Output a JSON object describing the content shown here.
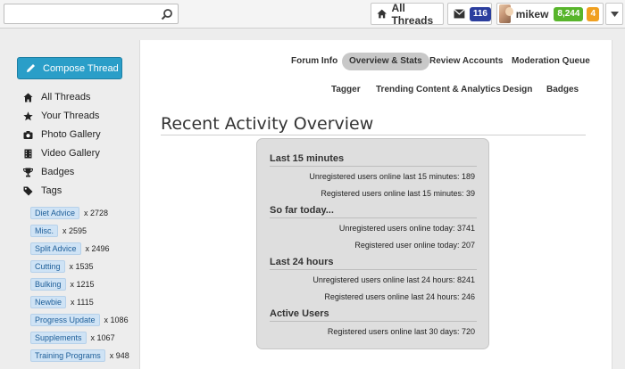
{
  "search": {
    "placeholder": ""
  },
  "topbar": {
    "all_threads_label": "All Threads",
    "mail_count": "116",
    "username": "mikew",
    "points": "8,244",
    "alerts": "4"
  },
  "sidebar": {
    "compose_label": "Compose Thread",
    "nav": [
      {
        "label": "All Threads",
        "icon": "home-icon"
      },
      {
        "label": "Your Threads",
        "icon": "star-icon"
      },
      {
        "label": "Photo Gallery",
        "icon": "camera-icon"
      },
      {
        "label": "Video Gallery",
        "icon": "video-icon"
      },
      {
        "label": "Badges",
        "icon": "trophy-icon"
      },
      {
        "label": "Tags",
        "icon": "tag-icon"
      }
    ],
    "tags": [
      {
        "name": "Diet Advice",
        "count": "x 2728"
      },
      {
        "name": "Misc.",
        "count": "x 2595"
      },
      {
        "name": "Split Advice",
        "count": "x 2496"
      },
      {
        "name": "Cutting",
        "count": "x 1535"
      },
      {
        "name": "Bulking",
        "count": "x 1215"
      },
      {
        "name": "Newbie",
        "count": "x 1115"
      },
      {
        "name": "Progress Update",
        "count": "x 1086"
      },
      {
        "name": "Supplements",
        "count": "x 1067"
      },
      {
        "name": "Training Programs",
        "count": "x 948"
      }
    ]
  },
  "tabs": {
    "row1": [
      "Forum Info",
      "Overview & Stats",
      "Review Accounts",
      "Moderation Queue"
    ],
    "row2": [
      "Tagger",
      "Trending Content & Analytics",
      "Design",
      "Badges"
    ],
    "active": "Overview & Stats"
  },
  "main": {
    "title": "Recent Activity Overview",
    "sections": [
      {
        "heading": "Last 15 minutes",
        "rows": [
          "Unregistered users online last 15 minutes: 189",
          "Registered users online last 15 minutes: 39"
        ]
      },
      {
        "heading": "So far today...",
        "rows": [
          "Unregistered users online today: 3741",
          "Registered user online today: 207"
        ]
      },
      {
        "heading": "Last 24 hours",
        "rows": [
          "Unregistered users online last 24 hours: 8241",
          "Registered users online last 24 hours: 246"
        ]
      },
      {
        "heading": "Active Users",
        "rows": [
          "Registered users online last 30 days: 720"
        ]
      }
    ]
  },
  "colors": {
    "accent": "#2a9ec8",
    "mail_badge": "#2b3e9e",
    "points_badge": "#58b52b",
    "alerts_badge": "#f0a020"
  }
}
